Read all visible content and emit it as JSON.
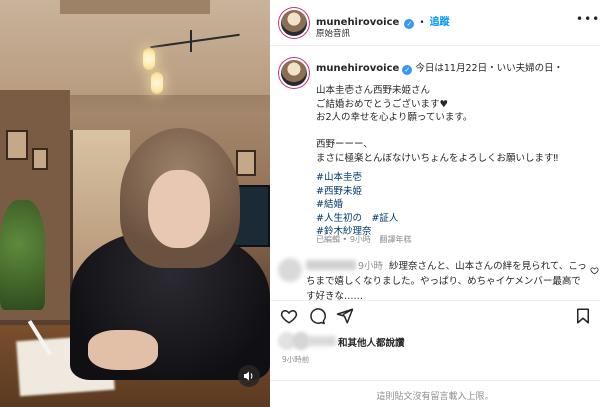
{
  "header": {
    "username": "munehirovoice",
    "follow_label": "追蹤",
    "subtitle": "原始音訊"
  },
  "caption": {
    "username": "munehirovoice",
    "headline": "今日は11月22日・いい夫婦の日・",
    "lines": [
      "山本圭壱さん西野未姫さん",
      "ご結婚おめでとうございます♥",
      "お2人の幸せを心より願っています。",
      "",
      "西野ーーー、",
      "まさに極楽とんぼなけいちょんをよろしくお願いします‼"
    ],
    "hashtags": [
      "#山本圭壱",
      "#西野未姫",
      "#結婚",
      "#人生初の　#証人",
      "#鈴木紗理奈"
    ],
    "edited": "已編輯",
    "time": "9小時",
    "translate": "翻譯年糕"
  },
  "comment": {
    "time": "9小時",
    "text": "紗理奈さんと、山本さんの絆を見られて、こっちまで嬉しくなりました。やっぱり、めちゃイケメンバー最高です好きな……"
  },
  "likes": {
    "text": "和其他人都說讚"
  },
  "post_time": "9小時前",
  "footer": {
    "text": "這則貼文沒有留言載入上限。"
  },
  "colors": {
    "accent": "#0095f6",
    "verified": "#3897f0",
    "hashtag": "#00376b",
    "meta": "#8e8e8e"
  },
  "icons": [
    "sound-icon",
    "more-icon",
    "heart-icon",
    "comment-icon",
    "share-icon",
    "bookmark-icon",
    "verified-icon"
  ]
}
